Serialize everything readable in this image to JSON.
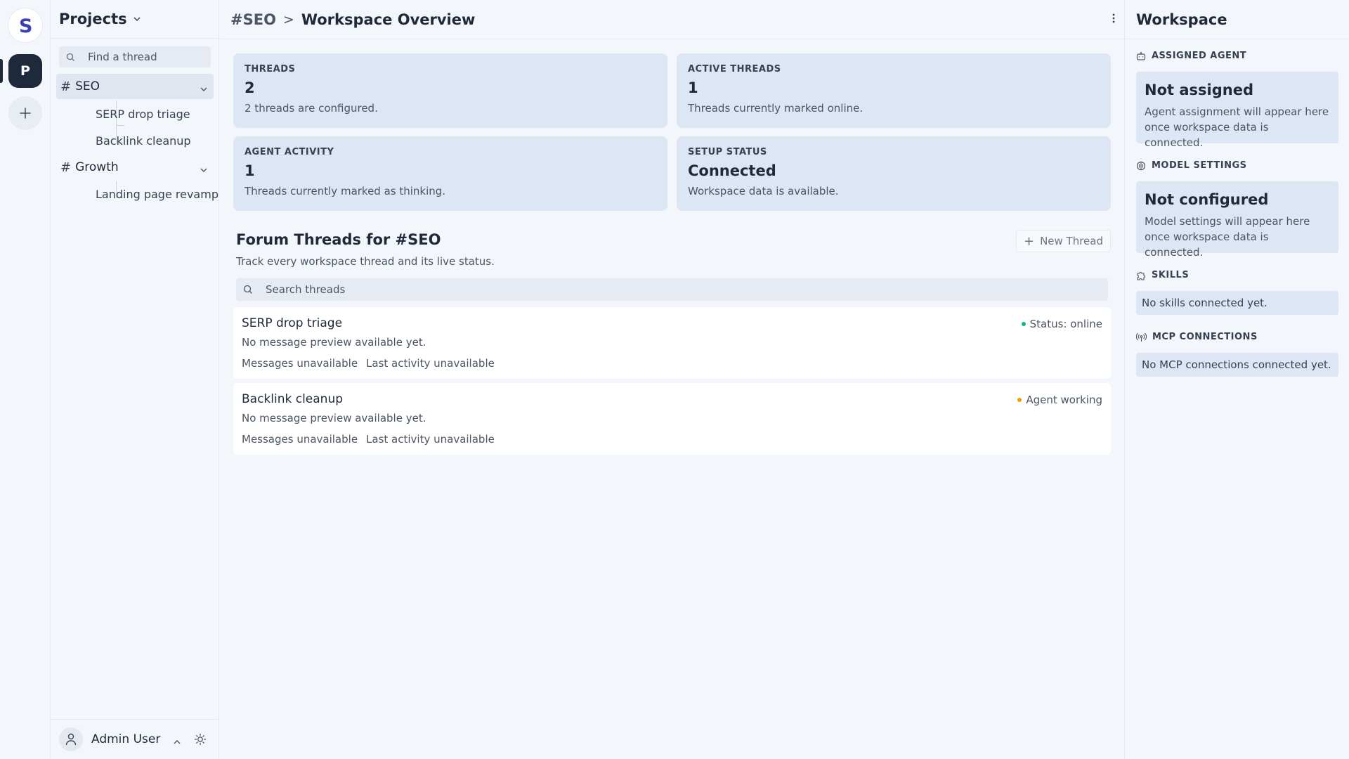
{
  "rail": {
    "logo_letter": "S",
    "project_letter": "P",
    "add_label": "+"
  },
  "sidebar": {
    "title": "Projects",
    "search_placeholder": "Find a thread",
    "channels": [
      {
        "name": "SEO",
        "threads": [
          "SERP drop triage",
          "Backlink cleanup"
        ]
      },
      {
        "name": "Growth",
        "threads": [
          "Landing page revamp"
        ]
      }
    ],
    "hash": "#",
    "user_name": "Admin User"
  },
  "topbar": {
    "channel": "#SEO",
    "separator": ">",
    "page": "Workspace Overview"
  },
  "stats": [
    {
      "label": "THREADS",
      "value": "2",
      "desc": "2 threads are configured."
    },
    {
      "label": "ACTIVE THREADS",
      "value": "1",
      "desc": "Threads currently marked online."
    },
    {
      "label": "AGENT ACTIVITY",
      "value": "1",
      "desc": "Threads currently marked as thinking."
    },
    {
      "label": "SETUP STATUS",
      "value": "Connected",
      "desc": "Workspace data is available."
    }
  ],
  "forum": {
    "title": "Forum Threads for #SEO",
    "subtitle": "Track every workspace thread and its live status.",
    "new_thread_label": "New Thread",
    "search_placeholder": "Search threads",
    "threads": [
      {
        "name": "SERP drop triage",
        "preview": "No message preview available yet.",
        "messages": "Messages unavailable",
        "last_activity": "Last activity unavailable",
        "status": "Status: online",
        "status_color": "#10b981"
      },
      {
        "name": "Backlink cleanup",
        "preview": "No message preview available yet.",
        "messages": "Messages unavailable",
        "last_activity": "Last activity unavailable",
        "status": "Agent working",
        "status_color": "#f59e0b"
      }
    ]
  },
  "workspace": {
    "title": "Workspace",
    "assigned_agent": {
      "label": "ASSIGNED AGENT",
      "title": "Not assigned",
      "desc": "Agent assignment will appear here once workspace data is connected."
    },
    "model_settings": {
      "label": "MODEL SETTINGS",
      "title": "Not configured",
      "desc": "Model settings will appear here once workspace data is connected."
    },
    "skills": {
      "label": "SKILLS",
      "text": "No skills connected yet."
    },
    "mcp": {
      "label": "MCP CONNECTIONS",
      "text": "No MCP connections connected yet."
    }
  },
  "colors": {
    "accent_dark": "#1e2a3b",
    "card_bg": "#dde6f4",
    "status_online": "#10b981",
    "status_working": "#f59e0b"
  }
}
